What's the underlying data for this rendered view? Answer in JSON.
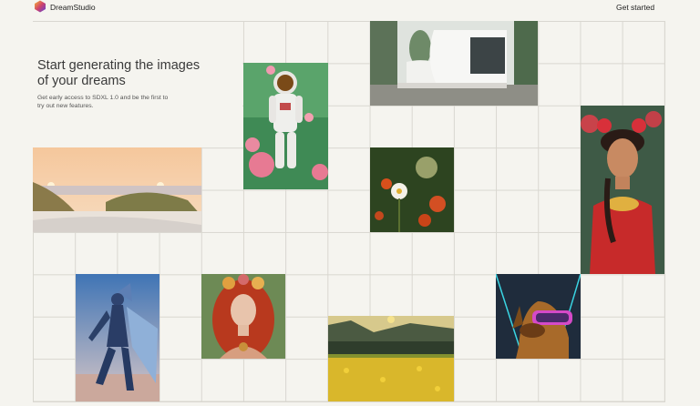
{
  "header": {
    "brand": "DreamStudio",
    "cta_label": "Get started"
  },
  "hero": {
    "headline": "Start generating the images of your dreams",
    "subtext": "Get early access to SDXL 1.0 and be the first to try out new features."
  },
  "gallery": [
    "astronaut-with-roses-image",
    "modern-architecture-image",
    "beach-dunes-sunset-image",
    "daisy-flower-image",
    "frida-portrait-image",
    "winged-robot-image",
    "red-haired-woman-image",
    "yellow-flower-field-image",
    "vr-dog-image"
  ],
  "colors": {
    "background": "#f5f4ef",
    "grid_lines": "#d9d7d0",
    "logo_gradient": [
      "#f7b733",
      "#a53bd8",
      "#3a6fe8"
    ]
  }
}
